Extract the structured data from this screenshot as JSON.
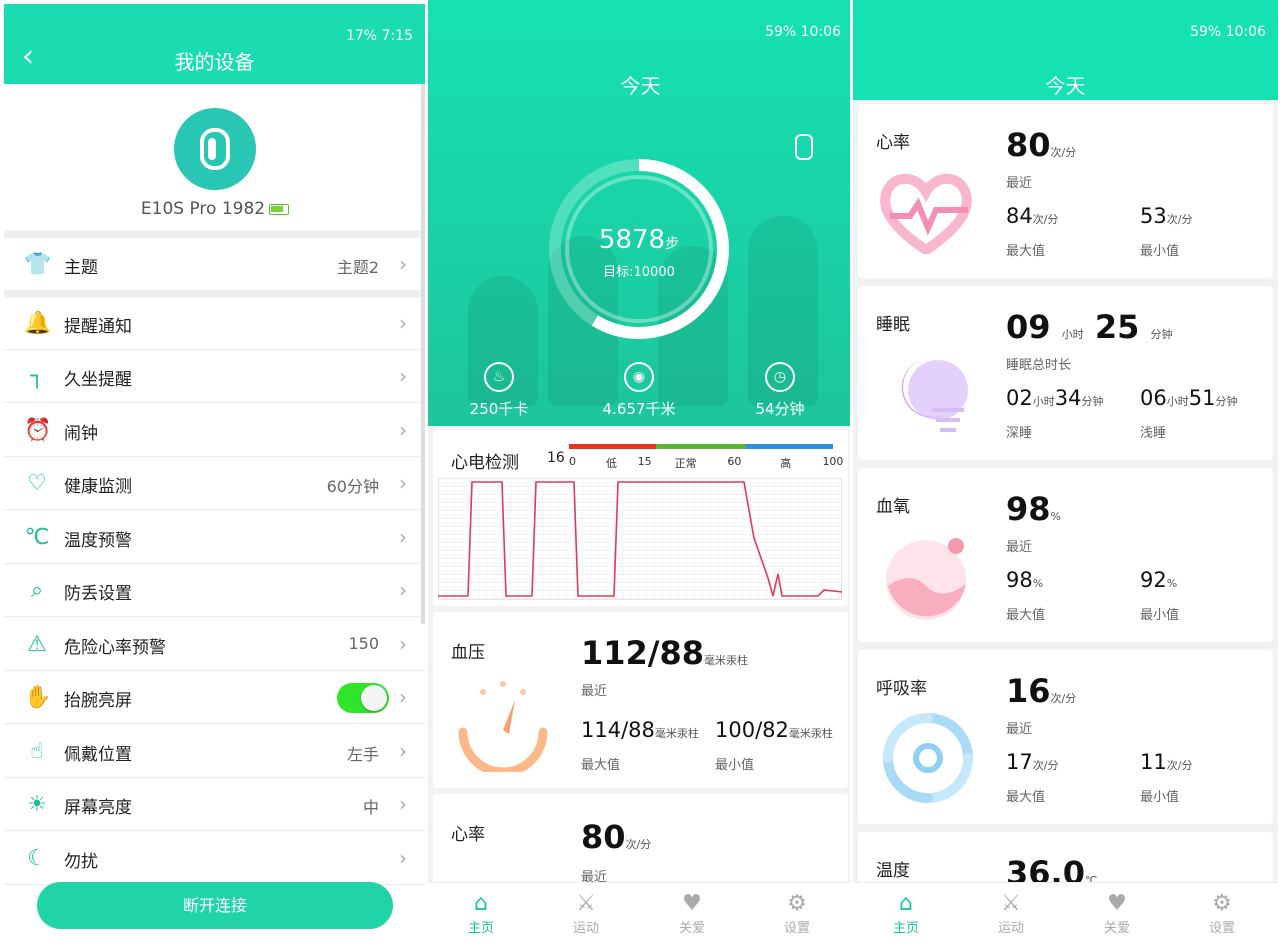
{
  "panel1": {
    "status": "17%  7:15",
    "title": "我的设备",
    "device_name": "E10S Pro 1982",
    "menu": [
      {
        "label": "主题",
        "value": "主题2",
        "icon": "shirt-icon"
      },
      {
        "label": "提醒通知",
        "value": "",
        "icon": "bell-icon"
      },
      {
        "label": "久坐提醒",
        "value": "",
        "icon": "sedentary-icon"
      },
      {
        "label": "闹钟",
        "value": "",
        "icon": "alarm-icon"
      },
      {
        "label": "健康监测",
        "value": "60分钟",
        "icon": "heart-pulse-icon"
      },
      {
        "label": "温度预警",
        "value": "",
        "icon": "thermometer-icon"
      },
      {
        "label": "防丢设置",
        "value": "",
        "icon": "search-icon"
      },
      {
        "label": "危险心率预警",
        "value": "150",
        "icon": "siren-icon"
      },
      {
        "label": "抬腕亮屏",
        "value": "",
        "icon": "wrist-icon",
        "toggle": true
      },
      {
        "label": "佩戴位置",
        "value": "左手",
        "icon": "thumb-icon"
      },
      {
        "label": "屏幕亮度",
        "value": "中",
        "icon": "sun-icon"
      },
      {
        "label": "勿扰",
        "value": "",
        "icon": "moon-icon"
      }
    ],
    "disconnect_label": "断开连接"
  },
  "panel2": {
    "status": "59%  10:06",
    "today": "今天",
    "steps": "5878",
    "steps_unit": "步",
    "goal": "目标:10000",
    "steps_progress": 0.5878,
    "stats": [
      {
        "icon": "flame-icon",
        "value": "250千卡"
      },
      {
        "icon": "location-icon",
        "value": "4.657千米"
      },
      {
        "icon": "clock-icon",
        "value": "54分钟"
      }
    ],
    "ecg": {
      "title": "心电检测",
      "value": "16",
      "legend_ticks": [
        "0",
        "低",
        "15",
        "正常",
        "60",
        "高",
        "100"
      ],
      "legend_colors": [
        "#e8311f",
        "#5bb537",
        "#2f8fe6"
      ]
    },
    "bp": {
      "label": "血压",
      "value": "112/88",
      "unit": "毫米汞柱",
      "recent": "最近",
      "max": "114/88",
      "max_unit": "毫米汞柱",
      "max_label": "最大值",
      "min": "100/82",
      "min_unit": "毫米汞柱",
      "min_label": "最小值"
    },
    "hr_peek": {
      "label": "心率",
      "value": "80",
      "unit": "次/分",
      "recent": "最近"
    }
  },
  "panel3": {
    "status": "59%  10:06",
    "today": "今天",
    "cards": [
      {
        "label": "心率",
        "value": "80",
        "unit": "次/分",
        "recent": "最近",
        "max": "84",
        "max_unit": "次/分",
        "max_label": "最大值",
        "min": "53",
        "min_unit": "次/分",
        "min_label": "最小值"
      },
      {
        "label": "睡眠",
        "h": "09",
        "h_unit": "小时",
        "m": "25",
        "m_unit": "分钟",
        "recent": "睡眠总时长",
        "deep_h": "02",
        "deep_m": "34",
        "light_h": "06",
        "light_m": "51",
        "deep_label": "深睡",
        "light_label": "浅睡",
        "hu": "小时",
        "mu": "分钟"
      },
      {
        "label": "血氧",
        "value": "98",
        "unit": "%",
        "recent": "最近",
        "max": "98",
        "max_unit": "%",
        "max_label": "最大值",
        "min": "92",
        "min_unit": "%",
        "min_label": "最小值"
      },
      {
        "label": "呼吸率",
        "value": "16",
        "unit": "次/分",
        "recent": "最近",
        "max": "17",
        "max_unit": "次/分",
        "max_label": "最大值",
        "min": "11",
        "min_unit": "次/分",
        "min_label": "最小值"
      },
      {
        "label": "温度",
        "value": "36.0",
        "unit": "℃"
      }
    ]
  },
  "tabs": [
    {
      "label": "主页",
      "icon": "home-icon"
    },
    {
      "label": "运动",
      "icon": "runner-icon"
    },
    {
      "label": "关爱",
      "icon": "heart-icon"
    },
    {
      "label": "设置",
      "icon": "gear-icon"
    }
  ]
}
